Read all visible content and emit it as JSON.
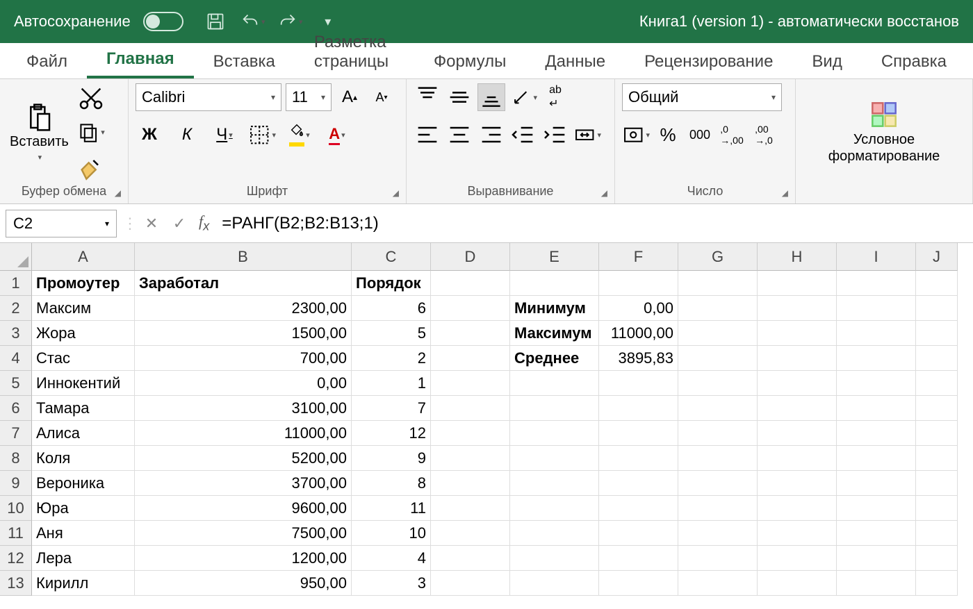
{
  "titlebar": {
    "autosave": "Автосохранение",
    "title": "Книга1 (version 1)  -  автоматически восстанов"
  },
  "tabs": [
    "Файл",
    "Главная",
    "Вставка",
    "Разметка страницы",
    "Формулы",
    "Данные",
    "Рецензирование",
    "Вид",
    "Справка"
  ],
  "active_tab": 1,
  "ribbon": {
    "clipboard": {
      "paste": "Вставить",
      "label": "Буфер обмена"
    },
    "font": {
      "name": "Calibri",
      "size": "11",
      "label": "Шрифт",
      "bold": "Ж",
      "italic": "К",
      "underline": "Ч"
    },
    "align": {
      "label": "Выравнивание"
    },
    "number": {
      "format": "Общий",
      "label": "Число"
    },
    "cond": {
      "label": "Условное форматирование"
    }
  },
  "namebox": "C2",
  "formula": "=РАНГ(B2;B2:B13;1)",
  "columns": [
    "A",
    "B",
    "C",
    "D",
    "E",
    "F",
    "G",
    "H",
    "I",
    "J"
  ],
  "col_widths": [
    "w-A",
    "w-B",
    "w-C",
    "w-D",
    "w-E",
    "w-F",
    "w-G",
    "w-H",
    "w-I",
    "w-J"
  ],
  "sheet": {
    "headers": {
      "A": "Промоутер",
      "B": "Заработал",
      "C": "Порядок"
    },
    "rows": [
      {
        "n": "2",
        "A": "Максим",
        "B": "2300,00",
        "C": "6",
        "E": "Минимум",
        "F": "0,00"
      },
      {
        "n": "3",
        "A": "Жора",
        "B": "1500,00",
        "C": "5",
        "E": "Максимум",
        "F": "11000,00"
      },
      {
        "n": "4",
        "A": "Стас",
        "B": "700,00",
        "C": "2",
        "E": "Среднее",
        "F": "3895,83"
      },
      {
        "n": "5",
        "A": "Иннокентий",
        "B": "0,00",
        "C": "1"
      },
      {
        "n": "6",
        "A": "Тамара",
        "B": "3100,00",
        "C": "7"
      },
      {
        "n": "7",
        "A": "Алиса",
        "B": "11000,00",
        "C": "12"
      },
      {
        "n": "8",
        "A": "Коля",
        "B": "5200,00",
        "C": "9"
      },
      {
        "n": "9",
        "A": "Вероника",
        "B": "3700,00",
        "C": "8"
      },
      {
        "n": "10",
        "A": "Юра",
        "B": "9600,00",
        "C": "11"
      },
      {
        "n": "11",
        "A": "Аня",
        "B": "7500,00",
        "C": "10"
      },
      {
        "n": "12",
        "A": "Лера",
        "B": "1200,00",
        "C": "4"
      },
      {
        "n": "13",
        "A": "Кирилл",
        "B": "950,00",
        "C": "3"
      }
    ]
  }
}
